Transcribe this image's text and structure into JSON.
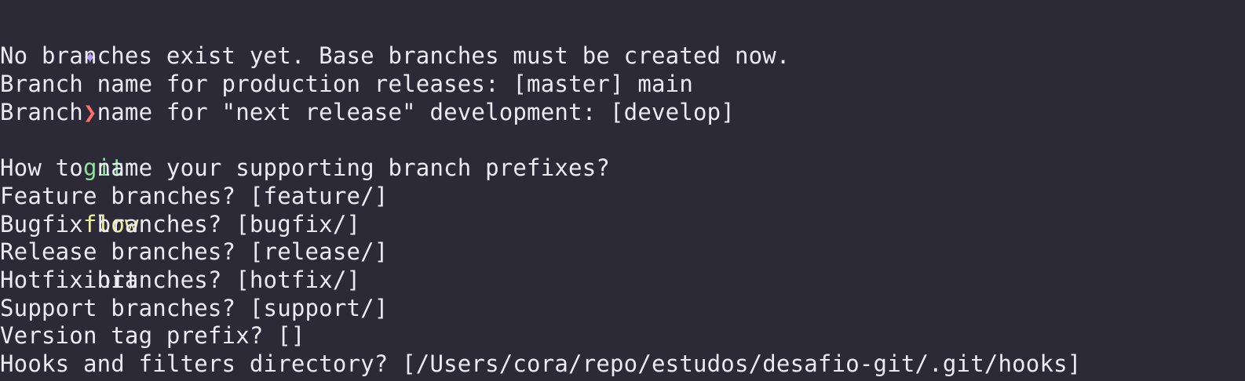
{
  "theme": {
    "background": "#2b2a36",
    "foreground": "#ecebf3",
    "accent_yellow": "#f4f3a0",
    "accent_cyan": "#7cd3e4",
    "accent_pink": "#ff6fa7",
    "prompt_star": "#b39cf2",
    "prompt_arrow": "#ff7068",
    "cmd_git": "#8ee39a",
    "cmd_flow": "#f0f29a"
  },
  "prompt_line": {
    "star_icon": "prompt-star-icon",
    "arrow_icon": "chevron-right-icon",
    "star": "✦",
    "arrow": "❯",
    "git": "git",
    "flow": "flow",
    "init": "init"
  },
  "output": {
    "no_branches": "No branches exist yet. Base branches must be created now.",
    "production_branch": "Branch name for production releases: [master] main",
    "next_release_branch": "Branch name for \"next release\" development: [develop]",
    "blank": "",
    "prefixes_question": "How to name your supporting branch prefixes?",
    "feature": "Feature branches? [feature/]",
    "bugfix": "Bugfix branches? [bugfix/]",
    "release": "Release branches? [release/]",
    "hotfix": "Hotfix branches? [hotfix/]",
    "support": "Support branches? [support/]",
    "version_tag": "Version tag prefix? []",
    "hooks": "Hooks and filters directory? [/Users/cora/repo/estudos/desafio-git/.git/hooks]"
  }
}
